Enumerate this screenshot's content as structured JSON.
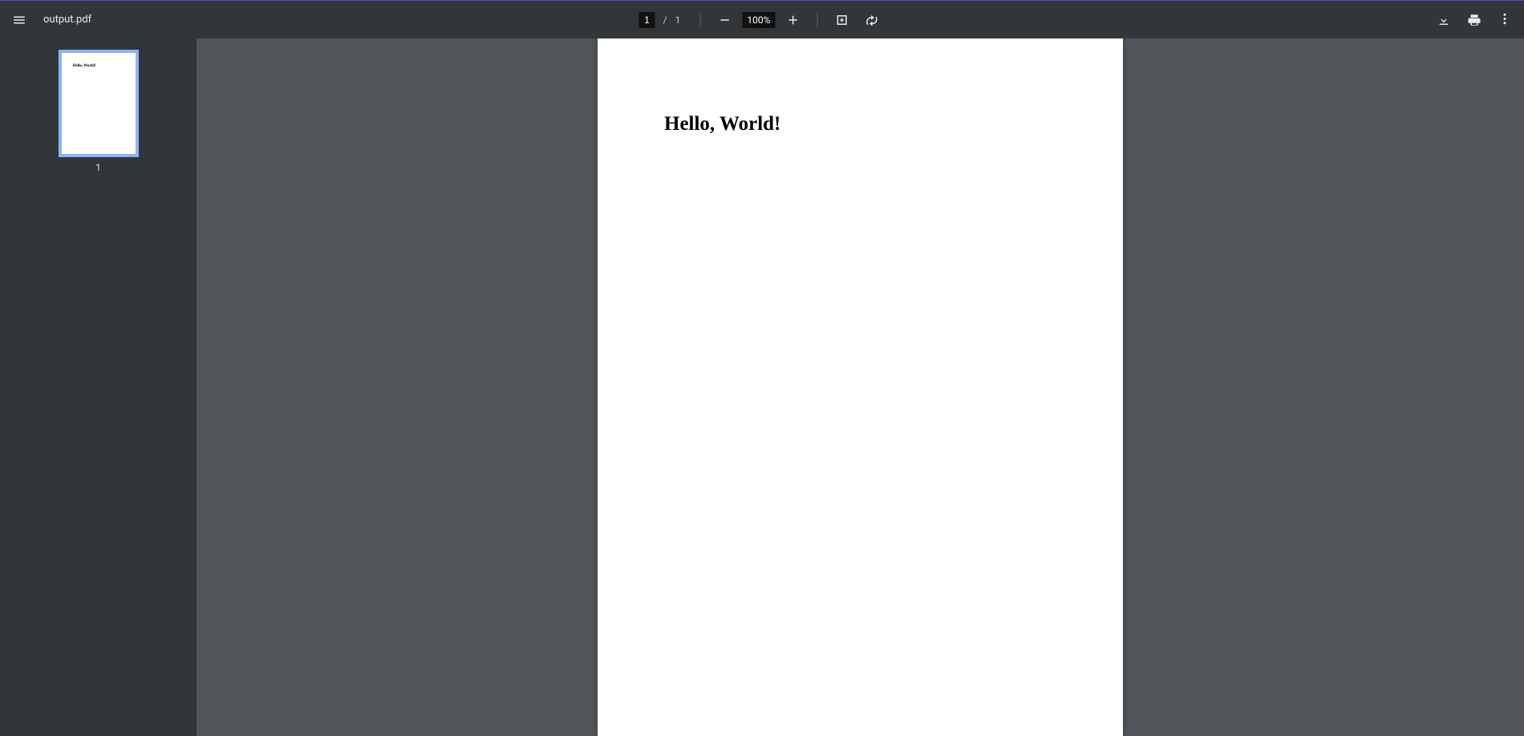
{
  "header": {
    "filename": "output.pdf"
  },
  "pager": {
    "current": "1",
    "separator": "/",
    "total": "1"
  },
  "zoom": {
    "level": "100%"
  },
  "sidebar": {
    "thumbnails": [
      {
        "label": "1",
        "preview_text": "Hello, World!"
      }
    ]
  },
  "document": {
    "heading": "Hello, World!"
  }
}
